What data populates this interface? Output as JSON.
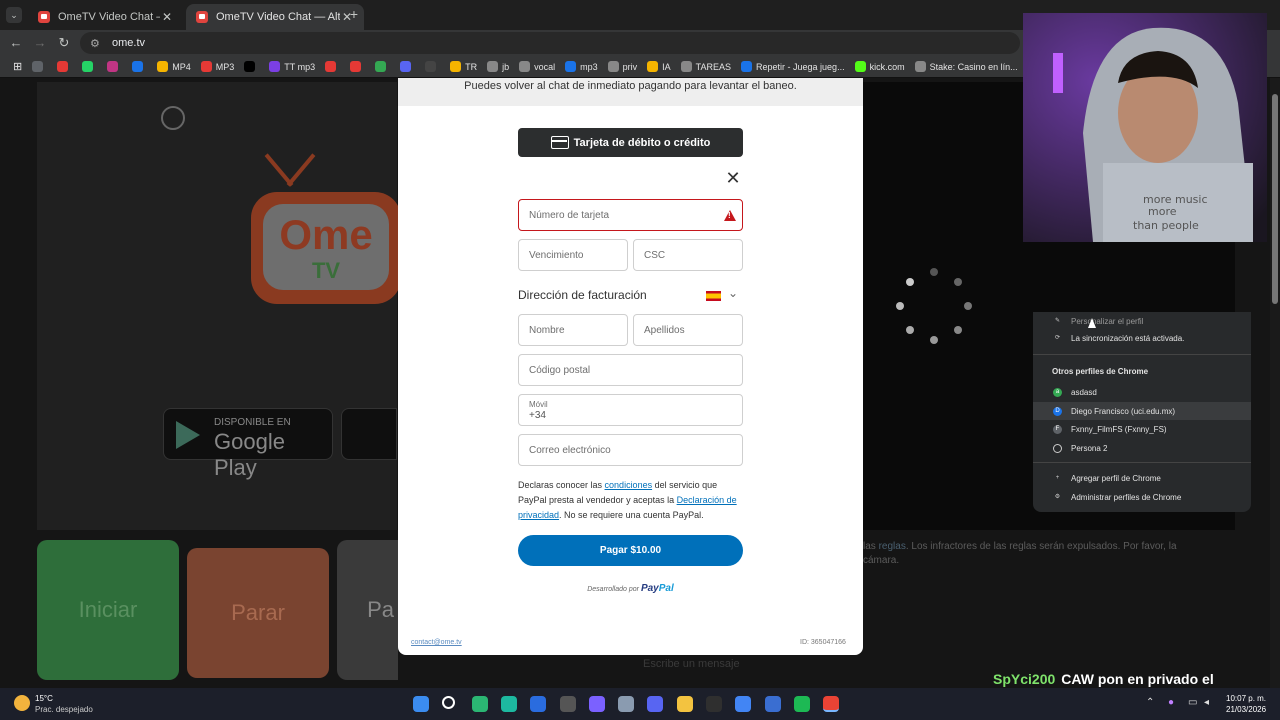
{
  "browser": {
    "tabs": [
      {
        "title": "OmeTV Video Chat — Alternat",
        "active": false
      },
      {
        "title": "OmeTV Video Chat — Alternat",
        "active": true
      }
    ],
    "new_tab_icon": "+",
    "url": "ome.tv",
    "bookmarks": [
      {
        "label": "",
        "color": "#5f6368"
      },
      {
        "label": "",
        "color": "#e53935"
      },
      {
        "label": "",
        "color": "#25d366"
      },
      {
        "label": "",
        "color": "#c13584"
      },
      {
        "label": "",
        "color": "#1a73e8"
      },
      {
        "label": "MP4",
        "color": "#f5b400"
      },
      {
        "label": "MP3",
        "color": "#e53935"
      },
      {
        "label": "",
        "color": "#000000"
      },
      {
        "label": "TT mp3",
        "color": "#7b3fe4"
      },
      {
        "label": "",
        "color": "#e53935"
      },
      {
        "label": "",
        "color": "#e53935"
      },
      {
        "label": "",
        "color": "#34a853"
      },
      {
        "label": "",
        "color": "#5865f2"
      },
      {
        "label": "",
        "color": "#444444"
      },
      {
        "label": "TR",
        "color": "#f5b400"
      },
      {
        "label": "jb",
        "color": "#888888"
      },
      {
        "label": "vocal",
        "color": "#888888"
      },
      {
        "label": "mp3",
        "color": "#1a73e8"
      },
      {
        "label": "priv",
        "color": "#888888"
      },
      {
        "label": "IA",
        "color": "#f5b400"
      },
      {
        "label": "TAREAS",
        "color": "#888888"
      },
      {
        "label": "Repetir - Juega jueg...",
        "color": "#1a73e8"
      },
      {
        "label": "kick.com",
        "color": "#53fc18"
      },
      {
        "label": "Stake: Casino en lín...",
        "color": "#888888"
      }
    ]
  },
  "page": {
    "start_button": "Iniciar",
    "stop_button": "Parar",
    "country_button": "Pa",
    "store_small": "DISPONIBLE EN",
    "store_large": "Google Play",
    "logo_top": "Ome",
    "logo_bottom": "TV",
    "rules_text_pre": "las",
    "rules_link": "reglas",
    "rules_text_post": ". Los infractores de las reglas serán expulsados. Por favor, la cámara.",
    "message_placeholder": "Escribe un mensaje"
  },
  "dialog": {
    "banner": "Puedes volver al chat de inmediato pagando para levantar el baneo.",
    "card_button": "Tarjeta de débito o crédito",
    "card_number_placeholder": "Número de tarjeta",
    "expiry_placeholder": "Vencimiento",
    "csc_placeholder": "CSC",
    "billing_heading": "Dirección de facturación",
    "first_name_placeholder": "Nombre",
    "last_name_placeholder": "Apellidos",
    "postal_placeholder": "Código postal",
    "mobile_label": "Móvil",
    "mobile_value": "+34",
    "email_placeholder": "Correo electrónico",
    "terms_1": "Declaras conocer las ",
    "terms_link_1": "condiciones",
    "terms_2": " del servicio que PayPal presta al vendedor y aceptas la ",
    "terms_link_2": "Declaración de privacidad",
    "terms_3": ". No se requiere una cuenta PayPal.",
    "pay_button": "Pagar $10.00",
    "powered_by": "Desarrollado por",
    "paypal_a": "Pay",
    "paypal_b": "Pal",
    "contact": "contact@ome.tv",
    "id": "ID: 365047166"
  },
  "profile_menu": {
    "customize": "Personalizar el perfil",
    "sync": "La sincronización está activada.",
    "others_heading": "Otros perfiles de Chrome",
    "profiles": [
      {
        "name": "asdasd",
        "initial": "a",
        "color": "#34a853"
      },
      {
        "name": "Diego Francisco (uci.edu.mx)",
        "initial": "D",
        "color": "#1a73e8"
      },
      {
        "name": "Fxnny_FilmFS (Fxnny_FS)",
        "initial": "F",
        "color": "#5f6368"
      },
      {
        "name": "Persona 2",
        "initial": "",
        "color": "#5f6368"
      }
    ],
    "add_profile": "Agregar perfil de Chrome",
    "manage_profiles": "Administrar perfiles de Chrome"
  },
  "webcam": {
    "shirt_text_1": "more music",
    "shirt_text_2": "more",
    "shirt_text_3": "than people"
  },
  "stream_chat": {
    "user": "SpYci200",
    "message": "CAW pon en privado el google"
  },
  "taskbar": {
    "temperature": "15°C",
    "weather": "Prac. despejado",
    "time": "10:07 p. m.",
    "date": "21/03/2026",
    "apps": [
      {
        "name": "windows-start-icon",
        "color": "#3b8cf0"
      },
      {
        "name": "search-icon",
        "color": "#ffffff"
      },
      {
        "name": "app-green-icon",
        "color": "#2bb673"
      },
      {
        "name": "app-heart-icon",
        "color": "#1db9a0"
      },
      {
        "name": "app-g-icon",
        "color": "#2a6cdf"
      },
      {
        "name": "app-m-icon",
        "color": "#555555"
      },
      {
        "name": "copilot-icon",
        "color": "#7b61ff"
      },
      {
        "name": "settings-icon",
        "color": "#8a9bb0"
      },
      {
        "name": "discord-icon",
        "color": "#5865f2"
      },
      {
        "name": "file-explorer-icon",
        "color": "#f3c340"
      },
      {
        "name": "epic-games-icon",
        "color": "#2f2f2f"
      },
      {
        "name": "chrome-icon",
        "color": "#4285f4"
      },
      {
        "name": "shield-app-icon",
        "color": "#3a6ed1"
      },
      {
        "name": "spotify-icon",
        "color": "#1db954"
      },
      {
        "name": "chrome-active-icon",
        "color": "#ea4335"
      }
    ]
  },
  "colors": {
    "paypal_blue": "#0070ba",
    "error_red": "#c5171c",
    "start_green": "#2e6e3a",
    "stop_orange": "#7a4430"
  }
}
